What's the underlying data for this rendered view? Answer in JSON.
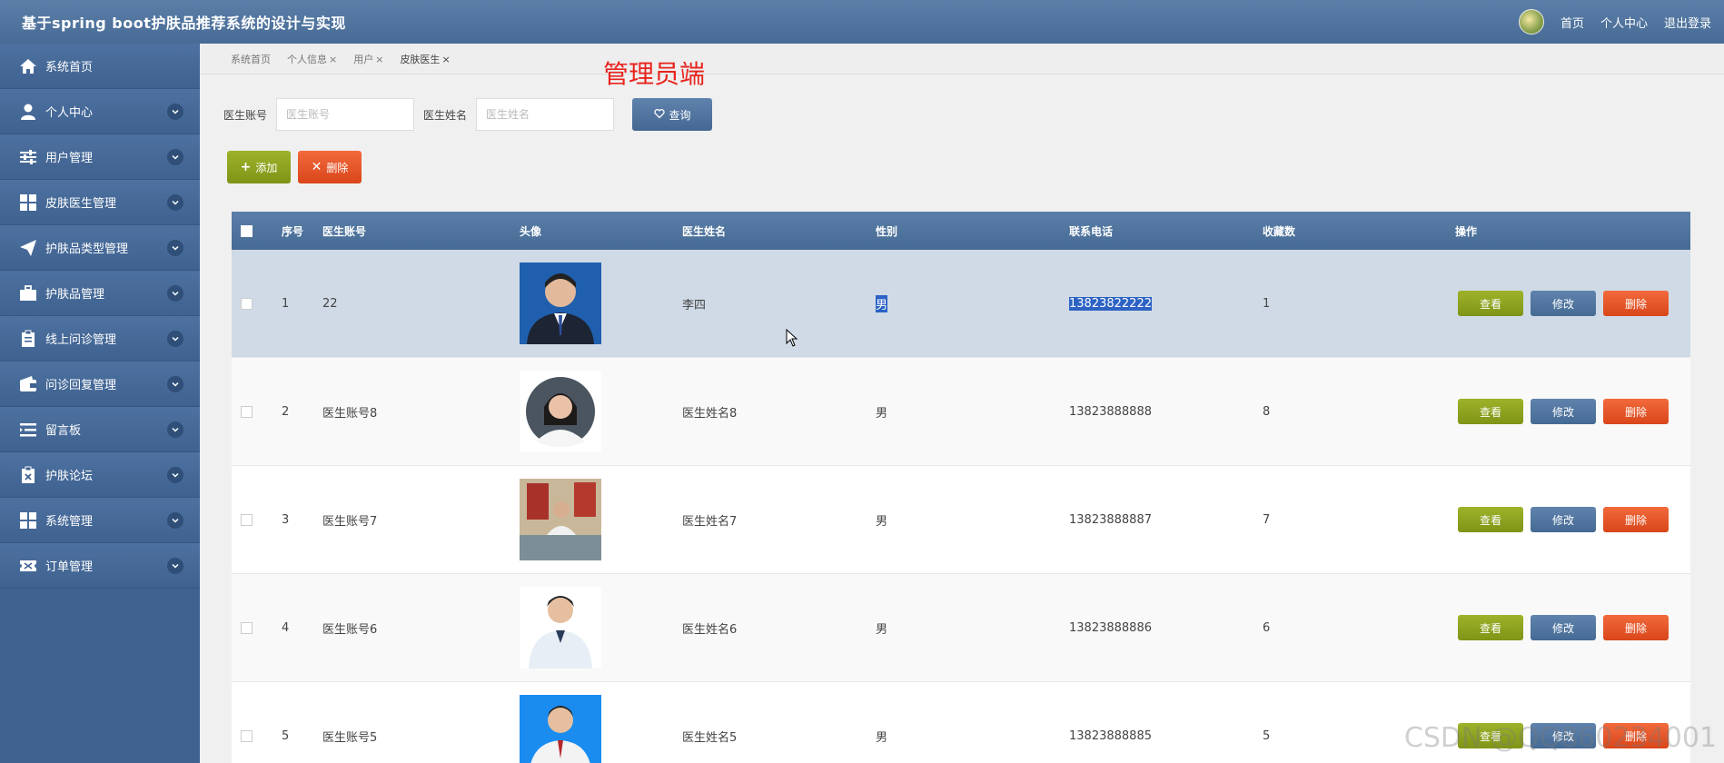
{
  "app": {
    "title": "基于spring boot护肤品推荐系统的设计与实现",
    "nav_home": "首页",
    "nav_profile": "个人中心",
    "nav_logout": "退出登录"
  },
  "sidebar": {
    "items": [
      {
        "label": "系统首页",
        "icon": "home-icon"
      },
      {
        "label": "个人中心",
        "icon": "user-icon"
      },
      {
        "label": "用户管理",
        "icon": "sliders-icon"
      },
      {
        "label": "皮肤医生管理",
        "icon": "grid-icon"
      },
      {
        "label": "护肤品类型管理",
        "icon": "paper-plane-icon"
      },
      {
        "label": "护肤品管理",
        "icon": "briefcase-icon"
      },
      {
        "label": "线上问诊管理",
        "icon": "clipboard-icon"
      },
      {
        "label": "问诊回复管理",
        "icon": "wallet-icon"
      },
      {
        "label": "留言板",
        "icon": "list-icon"
      },
      {
        "label": "护肤论坛",
        "icon": "clipboard-x-icon"
      },
      {
        "label": "系统管理",
        "icon": "grid-icon"
      },
      {
        "label": "订单管理",
        "icon": "ticket-icon"
      }
    ]
  },
  "tabs": [
    {
      "label": "系统首页",
      "closable": false
    },
    {
      "label": "个人信息",
      "closable": true
    },
    {
      "label": "用户",
      "closable": true
    },
    {
      "label": "皮肤医生",
      "closable": true
    }
  ],
  "tab_close": "×",
  "overlay_label": "管理员端",
  "search": {
    "account_label": "医生账号",
    "account_placeholder": "医生账号",
    "name_label": "医生姓名",
    "name_placeholder": "医生姓名",
    "query_button": "查询"
  },
  "actions": {
    "add": "添加",
    "delete": "删除"
  },
  "table": {
    "headers": [
      "序号",
      "医生账号",
      "头像",
      "医生姓名",
      "性别",
      "联系电话",
      "收藏数",
      "操作"
    ],
    "rows": [
      {
        "no": "1",
        "account": "22",
        "name": "李四",
        "gender": "男",
        "phone": "13823822222",
        "favorites": "1"
      },
      {
        "no": "2",
        "account": "医生账号8",
        "name": "医生姓名8",
        "gender": "男",
        "phone": "13823888888",
        "favorites": "8"
      },
      {
        "no": "3",
        "account": "医生账号7",
        "name": "医生姓名7",
        "gender": "男",
        "phone": "13823888887",
        "favorites": "7"
      },
      {
        "no": "4",
        "account": "医生账号6",
        "name": "医生姓名6",
        "gender": "男",
        "phone": "13823888886",
        "favorites": "6"
      },
      {
        "no": "5",
        "account": "医生账号5",
        "name": "医生姓名5",
        "gender": "男",
        "phone": "13823888885",
        "favorites": "5"
      }
    ],
    "row_buttons": {
      "view": "查看",
      "edit": "修改",
      "delete": "删除"
    }
  },
  "watermark": "CSDN @QQ860234001",
  "colors": {
    "header_blue": "#4f73a0",
    "view_green": "#8ea41f",
    "delete_orange": "#e5562a",
    "admin_red": "#e8231d"
  }
}
